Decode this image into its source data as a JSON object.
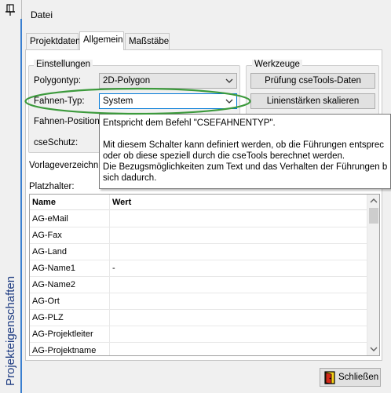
{
  "window": {
    "side_title": "Projekteigenschaften"
  },
  "menu": {
    "datei": "Datei"
  },
  "tabs": [
    "Projektdaten",
    "Allgemein",
    "Maßstäbe"
  ],
  "settings": {
    "group_title": "Einstellungen",
    "polygontyp_label": "Polygontyp:",
    "polygontyp_value": "2D-Polygon",
    "fahnentyp_label": "Fahnen-Typ:",
    "fahnentyp_value": "System",
    "fahnenposition_label": "Fahnen-Position:",
    "cseschutz_label": "cseSchutz:"
  },
  "tools": {
    "group_title": "Werkzeuge",
    "pruefung_button": "Prüfung cseTools-Daten",
    "linienstaerken_button": "Linienstärken skalieren"
  },
  "vorlage_label": "Vorlageverzeichnis",
  "platzhalter_label": "Platzhalter:",
  "tooltip": {
    "line1": "Entspricht dem Befehl \"CSEFAHNENTYP\".",
    "line2": "Mit diesem Schalter kann definiert werden, ob die Führungen entsprec",
    "line3": "oder ob diese speziell durch die cseTools berechnet werden.",
    "line4": "Die Bezugsmöglichkeiten zum Text und das Verhalten der Führungen b",
    "line5": "sich dadurch."
  },
  "table": {
    "headers": [
      "Name",
      "Wert"
    ],
    "rows": [
      [
        "AG-eMail",
        ""
      ],
      [
        "AG-Fax",
        ""
      ],
      [
        "AG-Land",
        ""
      ],
      [
        "AG-Name1",
        "-"
      ],
      [
        "AG-Name2",
        ""
      ],
      [
        "AG-Ort",
        ""
      ],
      [
        "AG-PLZ",
        ""
      ],
      [
        "AG-Projektleiter",
        ""
      ],
      [
        "AG-Projektname",
        ""
      ]
    ]
  },
  "footer": {
    "close_label": "Schließen"
  },
  "colors": {
    "accent_ellipse": "#3c9a3c",
    "title_blue": "#1e3c82",
    "selection_border": "#0078d7"
  }
}
